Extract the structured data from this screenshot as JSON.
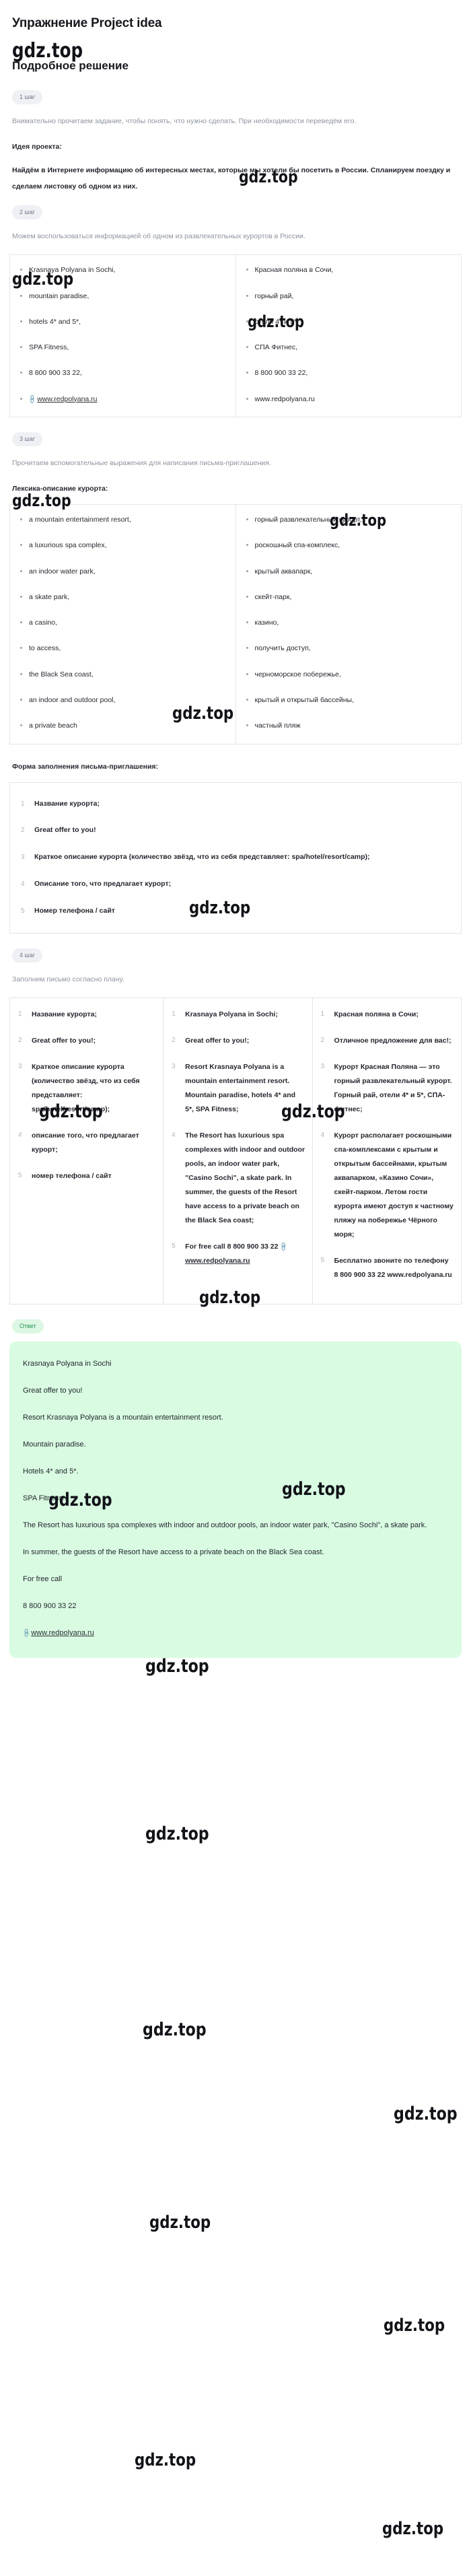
{
  "page": {
    "title": "Упражнение Project idea",
    "subtitle": "Подробное решение"
  },
  "watermark": {
    "text": "gdz.top"
  },
  "steps": {
    "step1_label": "1 шаг",
    "step2_label": "2 шаг",
    "step3_label": "3 шаг",
    "step4_label": "4 шаг",
    "answer_label": "Ответ"
  },
  "step1": {
    "intro": "Внимательно прочитаем задание, чтобы понять, что нужно сделать. При необходимости переведём его.",
    "heading": "Идея проекта:",
    "text": "Найдём в Интернете информацию об интересных местах, которые мы хотели бы посетить в России. Спланируем поездку и сделаем листовку об одном из них."
  },
  "step2": {
    "intro": "Можем воспользоваться информацией об одном из развлекательных курортов в России.",
    "table": {
      "left": [
        "Krasnaya Polyana in Sochi,",
        "mountain paradise,",
        "hotels 4* and 5*,",
        "SPA Fitness,",
        "8 800 900 33 22,",
        "www.redpolyana.ru"
      ],
      "right": [
        "Красная поляна в Сочи,",
        "горный рай,",
        "отели 4* и 5*,",
        "СПА Фитнес,",
        "8 800 900 33 22,",
        "www.redpolyana.ru"
      ]
    }
  },
  "step3": {
    "intro": "Прочитаем вспомогательные выражения для написания письма-приглашения.",
    "heading": "Лексика-описание курорта:",
    "table": {
      "left": [
        "a mountain entertainment resort,",
        "a luxurious spa complex,",
        "an indoor water park,",
        "a skate park,",
        "a casino,",
        "to access,",
        "the Black Sea coast,",
        "an indoor and outdoor pool,",
        "a private beach"
      ],
      "right": [
        "горный развлекательный курорт,",
        "роскошный спа-комплекс,",
        "крытый аквапарк,",
        "скейт-парк,",
        "казино,",
        "получить доступ,",
        "черноморское побережье,",
        "крытый и открытый бассейны,",
        "частный пляж"
      ]
    },
    "form_heading": "Форма заполнения письма-приглашения:",
    "form_items": [
      "Название курорта;",
      "Great offer to you!",
      "Краткое описание курорта (количество звёзд, что из себя представляет: spa/hotel/resort/camp);",
      "Описание того, что предлагает курорт;",
      "Номер телефона / сайт"
    ]
  },
  "step4": {
    "intro": "Заполним письмо согласно плану.",
    "columns": {
      "plan": [
        "Название курорта;",
        "Great offer to you!;",
        "Краткое описание курорта (количество звёзд, что из себя представляет: spa/hotel/resort/camp);",
        "описание того, что предлагает курорт;",
        "номер телефона / сайт"
      ],
      "english": [
        "Krasnaya Polyana in Sochi;",
        "Great offer to you!;",
        "Resort Krasnaya Polyana is a mountain entertainment resort. Mountain paradise, hotels 4* and 5*, SPA Fitness;",
        "The Resort has luxurious spa complexes with indoor and outdoor pools, an indoor water park, \"Casino Sochi\", a skate park. In summer, the guests of the Resort have access to a private beach on the Black Sea coast;",
        "For free call 8 800 900 33 22 www.redpolyana.ru"
      ],
      "english_item5_prefix": "For free call 8 800 900 33 22 ",
      "english_item5_link": "www.redpolyana.ru",
      "russian": [
        "Красная поляна в Сочи;",
        "Отличное предложение для вас!;",
        "Курорт Красная Поляна — это горный развлекательный курорт. Горный рай, отели 4* и 5*, СПА-фитнес;",
        "Курорт располагает роскошными спа-комплексами с крытым и открытым бассейнами, крытым аквапарком, «Казино Сочи», скейт-парком. Летом гости курорта имеют доступ к частному пляжу на побережье Чёрного моря;",
        "Бесплатно звоните по телефону 8 800 900 33 22 www.redpolyana.ru"
      ]
    }
  },
  "answer": {
    "lines": [
      "Krasnaya Polyana in Sochi",
      "Great offer to you!",
      "Resort Krasnaya Polyana is a mountain entertainment resort.",
      "Mountain paradise.",
      "Hotels 4* and 5*.",
      "SPA Fitness.",
      "The Resort has luxurious spa complexes with indoor and outdoor pools, an indoor water park, \"Casino Sochi\", a skate park.",
      "In summer, the guests of the Resort have access to a private beach on the Black Sea coast.",
      "For free call",
      "8 800 900 33 22"
    ],
    "link": "www.redpolyana.ru"
  },
  "colors": {
    "answer_bg": "#d9fbe2",
    "answer_badge_text": "#2a9153",
    "step_badge_bg": "#eef0f4",
    "muted_text": "#8d939d"
  }
}
